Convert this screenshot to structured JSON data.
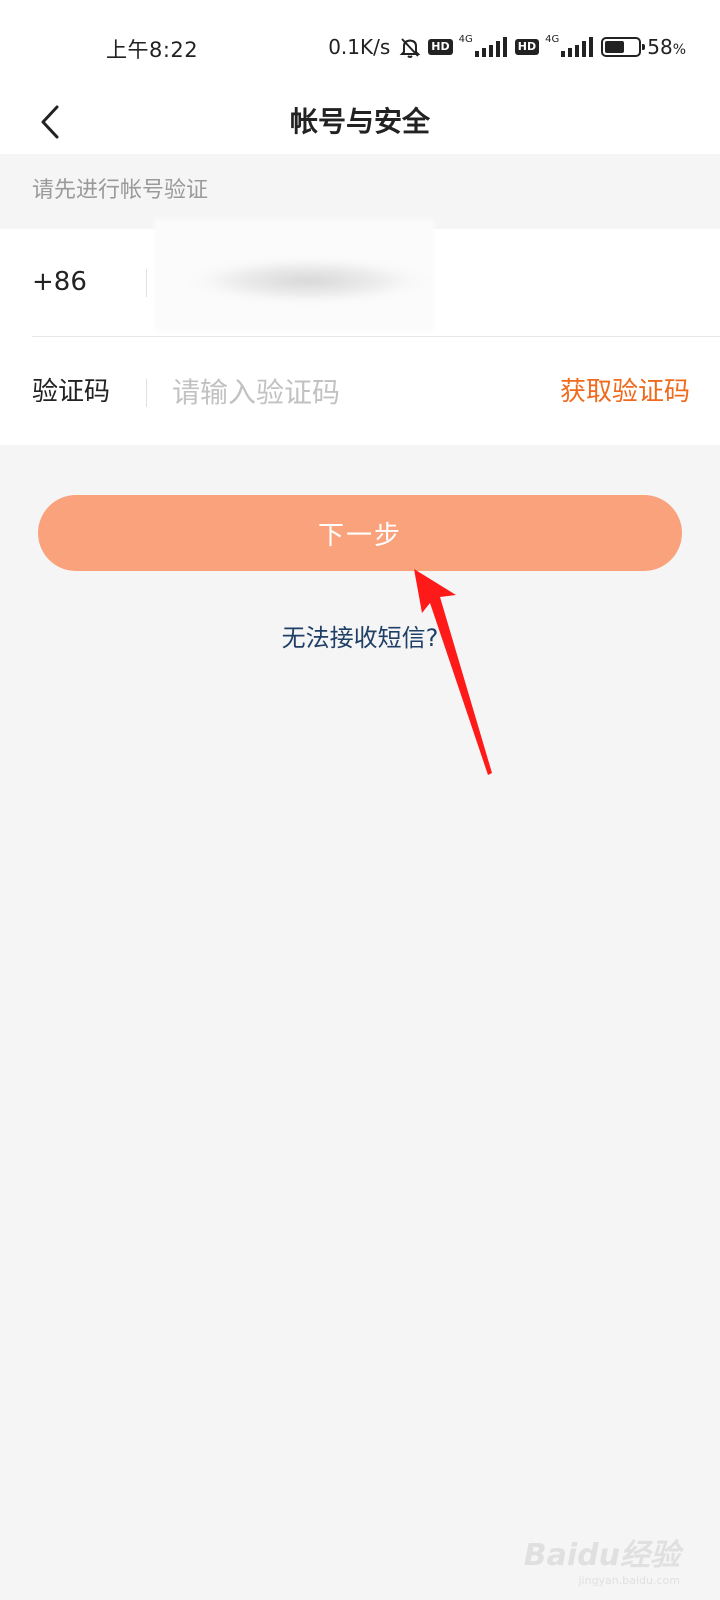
{
  "status_bar": {
    "time": "上午8:22",
    "net_speed": "0.1K/s",
    "hd_badge": "HD",
    "network_type": "4G",
    "battery_percent": "58",
    "battery_unit": "%",
    "battery_level": 0.58,
    "icons": [
      "mute-bell-icon",
      "hd-icon",
      "signal-icon",
      "battery-icon"
    ]
  },
  "nav": {
    "title": "帐号与安全",
    "back_icon": "chevron-left-icon"
  },
  "form": {
    "hint": "请先进行帐号验证",
    "country_code": "+86",
    "code_label": "验证码",
    "code_placeholder": "请输入验证码",
    "code_value": "",
    "get_code": "获取验证码"
  },
  "next_button": "下一步",
  "sms_link": "无法接收短信?",
  "watermark": {
    "text": "Baidu经验",
    "sub": "jingyan.baidu.com"
  },
  "colors": {
    "accent": "#f06a1e",
    "button_bg": "#f9a27c",
    "link": "#1f3f66",
    "arrow": "#ff1a1a"
  }
}
